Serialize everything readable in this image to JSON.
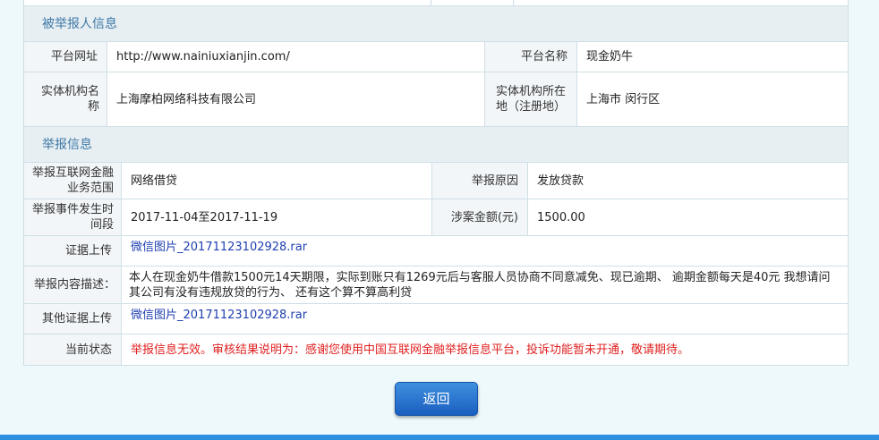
{
  "reported": {
    "section_title": "被举报人信息",
    "platform_url_label": "平台网址",
    "platform_url": "http://www.nainiuxianjin.com/",
    "platform_name_label": "平台名称",
    "platform_name": "现金奶牛",
    "entity_name_label": "实体机构名称",
    "entity_name": "上海摩柏网络科技有限公司",
    "entity_location_label": "实体机构所在地（注册地）",
    "entity_location": "上海市 闵行区"
  },
  "report": {
    "section_title": "举报信息",
    "scope_label": "举报互联网金融业务范围",
    "scope": "网络借贷",
    "reason_label": "举报原因",
    "reason": "发放贷款",
    "period_label": "举报事件发生时间段",
    "period": "2017-11-04至2017-11-19",
    "amount_label": "涉案金额(元)",
    "amount": "1500.00",
    "evidence_label": "证据上传",
    "evidence_file": "微信图片_20171123102928.rar",
    "description_label": "举报内容描述：",
    "description": "本人在现金奶牛借款1500元14天期限，实际到账只有1269元后与客服人员协商不同意减免、现已逾期、 逾期金额每天是40元 我想请问其公司有没有违规放贷的行为、 还有这个算不算高利贷",
    "other_evidence_label": "其他证据上传",
    "other_evidence_file": "微信图片_20171123102928.rar",
    "status_label": "当前状态",
    "status": "举报信息无效。审核结果说明为：感谢您使用中国互联网金融举报信息平台，投诉功能暂未开通，敬请期待。"
  },
  "actions": {
    "back_label": "返回"
  },
  "colors": {
    "accent": "#3f79a6",
    "button": "#2a76cf",
    "status": "#e02020"
  }
}
